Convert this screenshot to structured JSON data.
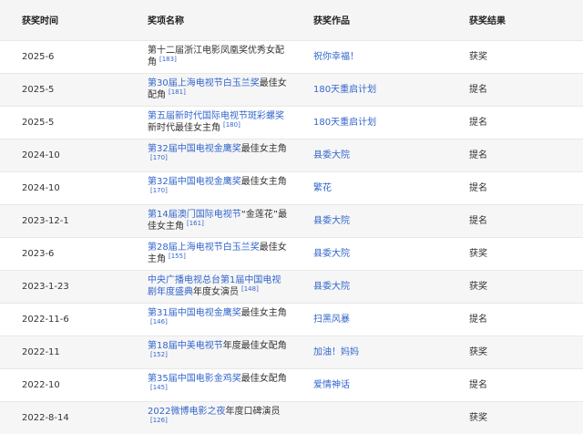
{
  "headers": [
    "获奖时间",
    "奖项名称",
    "获奖作品",
    "获奖结果"
  ],
  "rows": [
    {
      "date": "2025-6",
      "award": [
        {
          "t": "第十二届浙江电影凤凰奖优秀女配角",
          "link": false
        }
      ],
      "ref": "[183]",
      "work": "祝你幸福！",
      "result": "获奖"
    },
    {
      "date": "2025-5",
      "award": [
        {
          "t": "第30届上海电视节白玉兰奖",
          "link": true
        },
        {
          "t": "最佳女配角",
          "link": false
        }
      ],
      "ref": "[181]",
      "work": "180天重启计划",
      "result": "提名"
    },
    {
      "date": "2025-5",
      "award": [
        {
          "t": "第五届新时代国际电视节斑彩螺奖",
          "link": true
        },
        {
          "t": "新时代最佳女主角",
          "link": false
        }
      ],
      "ref": "[180]",
      "work": "180天重启计划",
      "result": "提名"
    },
    {
      "date": "2024-10",
      "award": [
        {
          "t": "第32届中国电视金鹰奖",
          "link": true
        },
        {
          "t": "最佳女主角",
          "link": false
        }
      ],
      "ref": "[170]",
      "work": "县委大院",
      "result": "提名"
    },
    {
      "date": "2024-10",
      "award": [
        {
          "t": "第32届中国电视金鹰奖",
          "link": true
        },
        {
          "t": "最佳女主角",
          "link": false
        }
      ],
      "ref": "[170]",
      "work": "繁花",
      "result": "提名"
    },
    {
      "date": "2023-12-1",
      "award": [
        {
          "t": "第14届澳门国际电视节",
          "link": true
        },
        {
          "t": "“金莲花”最佳女主角",
          "link": false
        }
      ],
      "ref": "[161]",
      "work": "县委大院",
      "result": "提名"
    },
    {
      "date": "2023-6",
      "award": [
        {
          "t": "第28届上海电视节白玉兰奖",
          "link": true
        },
        {
          "t": "最佳女主角",
          "link": false
        }
      ],
      "ref": "[155]",
      "work": "县委大院",
      "result": "获奖"
    },
    {
      "date": "2023-1-23",
      "award": [
        {
          "t": "中央广播电视总台第1届中国电视剧年度盛典",
          "link": true
        },
        {
          "t": "年度女演员",
          "link": false
        }
      ],
      "ref": "[148]",
      "work": "县委大院",
      "result": "获奖"
    },
    {
      "date": "2022-11-6",
      "award": [
        {
          "t": "第31届中国电视金鹰奖",
          "link": true
        },
        {
          "t": "最佳女主角",
          "link": false
        }
      ],
      "ref": "[146]",
      "work": "扫黑风暴",
      "result": "提名"
    },
    {
      "date": "2022-11",
      "award": [
        {
          "t": "第18届中美电视节",
          "link": true
        },
        {
          "t": "年度最佳女配角",
          "link": false
        }
      ],
      "ref": "[152]",
      "work": "加油！妈妈",
      "result": "获奖"
    },
    {
      "date": "2022-10",
      "award": [
        {
          "t": "第35届中国电影金鸡奖",
          "link": true
        },
        {
          "t": "最佳女配角",
          "link": false
        }
      ],
      "ref": "[145]",
      "work": "爱情神话",
      "result": "提名"
    },
    {
      "date": "2022-8-14",
      "award": [
        {
          "t": "2022微博电影之夜",
          "link": true
        },
        {
          "t": "年度口碑演员",
          "link": false
        }
      ],
      "ref": "[126]",
      "work": "",
      "result": "获奖"
    }
  ]
}
